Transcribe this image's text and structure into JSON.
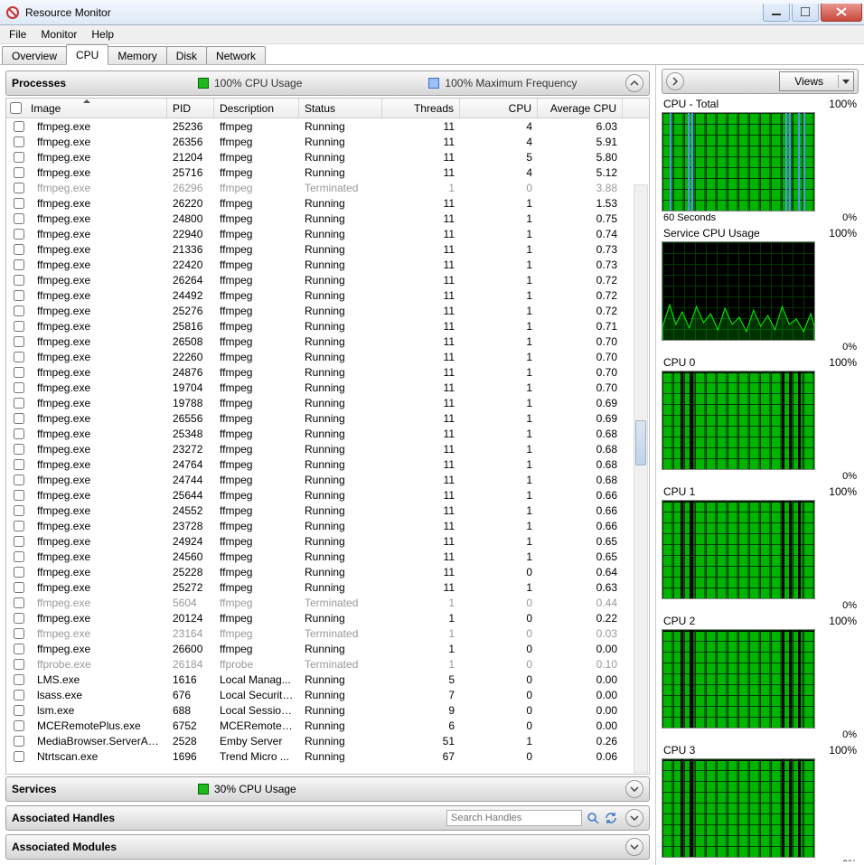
{
  "window": {
    "title": "Resource Monitor"
  },
  "menu": [
    "File",
    "Monitor",
    "Help"
  ],
  "tabs": [
    "Overview",
    "CPU",
    "Memory",
    "Disk",
    "Network"
  ],
  "active_tab": 1,
  "processes_section": {
    "title": "Processes",
    "cpu_usage": "100% CPU Usage",
    "max_freq": "100% Maximum Frequency"
  },
  "columns": [
    "Image",
    "PID",
    "Description",
    "Status",
    "Threads",
    "CPU",
    "Average CPU"
  ],
  "rows": [
    {
      "image": "ffmpeg.exe",
      "pid": 25236,
      "desc": "ffmpeg",
      "status": "Running",
      "threads": 11,
      "cpu": 4,
      "avg": "6.03",
      "term": false
    },
    {
      "image": "ffmpeg.exe",
      "pid": 26356,
      "desc": "ffmpeg",
      "status": "Running",
      "threads": 11,
      "cpu": 4,
      "avg": "5.91",
      "term": false
    },
    {
      "image": "ffmpeg.exe",
      "pid": 21204,
      "desc": "ffmpeg",
      "status": "Running",
      "threads": 11,
      "cpu": 5,
      "avg": "5.80",
      "term": false
    },
    {
      "image": "ffmpeg.exe",
      "pid": 25716,
      "desc": "ffmpeg",
      "status": "Running",
      "threads": 11,
      "cpu": 4,
      "avg": "5.12",
      "term": false
    },
    {
      "image": "ffmpeg.exe",
      "pid": 26296,
      "desc": "ffmpeg",
      "status": "Terminated",
      "threads": 1,
      "cpu": 0,
      "avg": "3.88",
      "term": true
    },
    {
      "image": "ffmpeg.exe",
      "pid": 26220,
      "desc": "ffmpeg",
      "status": "Running",
      "threads": 11,
      "cpu": 1,
      "avg": "1.53",
      "term": false
    },
    {
      "image": "ffmpeg.exe",
      "pid": 24800,
      "desc": "ffmpeg",
      "status": "Running",
      "threads": 11,
      "cpu": 1,
      "avg": "0.75",
      "term": false
    },
    {
      "image": "ffmpeg.exe",
      "pid": 22940,
      "desc": "ffmpeg",
      "status": "Running",
      "threads": 11,
      "cpu": 1,
      "avg": "0.74",
      "term": false
    },
    {
      "image": "ffmpeg.exe",
      "pid": 21336,
      "desc": "ffmpeg",
      "status": "Running",
      "threads": 11,
      "cpu": 1,
      "avg": "0.73",
      "term": false
    },
    {
      "image": "ffmpeg.exe",
      "pid": 22420,
      "desc": "ffmpeg",
      "status": "Running",
      "threads": 11,
      "cpu": 1,
      "avg": "0.73",
      "term": false
    },
    {
      "image": "ffmpeg.exe",
      "pid": 26264,
      "desc": "ffmpeg",
      "status": "Running",
      "threads": 11,
      "cpu": 1,
      "avg": "0.72",
      "term": false
    },
    {
      "image": "ffmpeg.exe",
      "pid": 24492,
      "desc": "ffmpeg",
      "status": "Running",
      "threads": 11,
      "cpu": 1,
      "avg": "0.72",
      "term": false
    },
    {
      "image": "ffmpeg.exe",
      "pid": 25276,
      "desc": "ffmpeg",
      "status": "Running",
      "threads": 11,
      "cpu": 1,
      "avg": "0.72",
      "term": false
    },
    {
      "image": "ffmpeg.exe",
      "pid": 25816,
      "desc": "ffmpeg",
      "status": "Running",
      "threads": 11,
      "cpu": 1,
      "avg": "0.71",
      "term": false
    },
    {
      "image": "ffmpeg.exe",
      "pid": 26508,
      "desc": "ffmpeg",
      "status": "Running",
      "threads": 11,
      "cpu": 1,
      "avg": "0.70",
      "term": false
    },
    {
      "image": "ffmpeg.exe",
      "pid": 22260,
      "desc": "ffmpeg",
      "status": "Running",
      "threads": 11,
      "cpu": 1,
      "avg": "0.70",
      "term": false
    },
    {
      "image": "ffmpeg.exe",
      "pid": 24876,
      "desc": "ffmpeg",
      "status": "Running",
      "threads": 11,
      "cpu": 1,
      "avg": "0.70",
      "term": false
    },
    {
      "image": "ffmpeg.exe",
      "pid": 19704,
      "desc": "ffmpeg",
      "status": "Running",
      "threads": 11,
      "cpu": 1,
      "avg": "0.70",
      "term": false
    },
    {
      "image": "ffmpeg.exe",
      "pid": 19788,
      "desc": "ffmpeg",
      "status": "Running",
      "threads": 11,
      "cpu": 1,
      "avg": "0.69",
      "term": false
    },
    {
      "image": "ffmpeg.exe",
      "pid": 26556,
      "desc": "ffmpeg",
      "status": "Running",
      "threads": 11,
      "cpu": 1,
      "avg": "0.69",
      "term": false
    },
    {
      "image": "ffmpeg.exe",
      "pid": 25348,
      "desc": "ffmpeg",
      "status": "Running",
      "threads": 11,
      "cpu": 1,
      "avg": "0.68",
      "term": false
    },
    {
      "image": "ffmpeg.exe",
      "pid": 23272,
      "desc": "ffmpeg",
      "status": "Running",
      "threads": 11,
      "cpu": 1,
      "avg": "0.68",
      "term": false
    },
    {
      "image": "ffmpeg.exe",
      "pid": 24764,
      "desc": "ffmpeg",
      "status": "Running",
      "threads": 11,
      "cpu": 1,
      "avg": "0.68",
      "term": false
    },
    {
      "image": "ffmpeg.exe",
      "pid": 24744,
      "desc": "ffmpeg",
      "status": "Running",
      "threads": 11,
      "cpu": 1,
      "avg": "0.68",
      "term": false
    },
    {
      "image": "ffmpeg.exe",
      "pid": 25644,
      "desc": "ffmpeg",
      "status": "Running",
      "threads": 11,
      "cpu": 1,
      "avg": "0.66",
      "term": false
    },
    {
      "image": "ffmpeg.exe",
      "pid": 24552,
      "desc": "ffmpeg",
      "status": "Running",
      "threads": 11,
      "cpu": 1,
      "avg": "0.66",
      "term": false
    },
    {
      "image": "ffmpeg.exe",
      "pid": 23728,
      "desc": "ffmpeg",
      "status": "Running",
      "threads": 11,
      "cpu": 1,
      "avg": "0.66",
      "term": false
    },
    {
      "image": "ffmpeg.exe",
      "pid": 24924,
      "desc": "ffmpeg",
      "status": "Running",
      "threads": 11,
      "cpu": 1,
      "avg": "0.65",
      "term": false
    },
    {
      "image": "ffmpeg.exe",
      "pid": 24560,
      "desc": "ffmpeg",
      "status": "Running",
      "threads": 11,
      "cpu": 1,
      "avg": "0.65",
      "term": false
    },
    {
      "image": "ffmpeg.exe",
      "pid": 25228,
      "desc": "ffmpeg",
      "status": "Running",
      "threads": 11,
      "cpu": 0,
      "avg": "0.64",
      "term": false
    },
    {
      "image": "ffmpeg.exe",
      "pid": 25272,
      "desc": "ffmpeg",
      "status": "Running",
      "threads": 11,
      "cpu": 1,
      "avg": "0.63",
      "term": false
    },
    {
      "image": "ffmpeg.exe",
      "pid": 5604,
      "desc": "ffmpeg",
      "status": "Terminated",
      "threads": 1,
      "cpu": 0,
      "avg": "0.44",
      "term": true
    },
    {
      "image": "ffmpeg.exe",
      "pid": 20124,
      "desc": "ffmpeg",
      "status": "Running",
      "threads": 1,
      "cpu": 0,
      "avg": "0.22",
      "term": false
    },
    {
      "image": "ffmpeg.exe",
      "pid": 23164,
      "desc": "ffmpeg",
      "status": "Terminated",
      "threads": 1,
      "cpu": 0,
      "avg": "0.03",
      "term": true
    },
    {
      "image": "ffmpeg.exe",
      "pid": 26600,
      "desc": "ffmpeg",
      "status": "Running",
      "threads": 1,
      "cpu": 0,
      "avg": "0.00",
      "term": false
    },
    {
      "image": "ffprobe.exe",
      "pid": 26184,
      "desc": "ffprobe",
      "status": "Terminated",
      "threads": 1,
      "cpu": 0,
      "avg": "0.10",
      "term": true
    },
    {
      "image": "LMS.exe",
      "pid": 1616,
      "desc": "Local Manag...",
      "status": "Running",
      "threads": 5,
      "cpu": 0,
      "avg": "0.00",
      "term": false
    },
    {
      "image": "lsass.exe",
      "pid": 676,
      "desc": "Local Security...",
      "status": "Running",
      "threads": 7,
      "cpu": 0,
      "avg": "0.00",
      "term": false
    },
    {
      "image": "lsm.exe",
      "pid": 688,
      "desc": "Local Session...",
      "status": "Running",
      "threads": 9,
      "cpu": 0,
      "avg": "0.00",
      "term": false
    },
    {
      "image": "MCERemotePlus.exe",
      "pid": 6752,
      "desc": "MCERemoteP...",
      "status": "Running",
      "threads": 6,
      "cpu": 0,
      "avg": "0.00",
      "term": false
    },
    {
      "image": "MediaBrowser.ServerApplic...",
      "pid": 2528,
      "desc": "Emby Server",
      "status": "Running",
      "threads": 51,
      "cpu": 1,
      "avg": "0.26",
      "term": false
    },
    {
      "image": "Ntrtscan.exe",
      "pid": 1696,
      "desc": "Trend Micro ...",
      "status": "Running",
      "threads": 67,
      "cpu": 0,
      "avg": "0.06",
      "term": false
    }
  ],
  "services_section": {
    "title": "Services",
    "cpu_usage": "30% CPU Usage"
  },
  "handles_section": {
    "title": "Associated Handles",
    "search_placeholder": "Search Handles"
  },
  "modules_section": {
    "title": "Associated Modules"
  },
  "right_pane": {
    "views": "Views",
    "graphs": [
      {
        "title": "CPU - Total",
        "pct": "100%",
        "foot_left": "60 Seconds",
        "foot_right": "0%",
        "type": "cpu-total"
      },
      {
        "title": "Service CPU Usage",
        "pct": "100%",
        "foot_left": "",
        "foot_right": "0%",
        "type": "service"
      },
      {
        "title": "CPU 0",
        "pct": "100%",
        "foot_left": "",
        "foot_right": "0%",
        "type": "cpu-core"
      },
      {
        "title": "CPU 1",
        "pct": "100%",
        "foot_left": "",
        "foot_right": "0%",
        "type": "cpu-core"
      },
      {
        "title": "CPU 2",
        "pct": "100%",
        "foot_left": "",
        "foot_right": "0%",
        "type": "cpu-core"
      },
      {
        "title": "CPU 3",
        "pct": "100%",
        "foot_left": "",
        "foot_right": "0%",
        "type": "cpu-core"
      }
    ]
  },
  "chart_data": {
    "type": "line",
    "note": "Per-core CPU% over the last 60 seconds; all cores sustained ~100%. Service CPU Usage fluctuates ~5–40%.",
    "x_range_seconds": [
      0,
      60
    ],
    "y_range_pct": [
      0,
      100
    ],
    "series": [
      {
        "name": "CPU - Total",
        "approx_pct": 100
      },
      {
        "name": "Service CPU Usage",
        "approx_pct_range": [
          5,
          40
        ]
      },
      {
        "name": "CPU 0",
        "approx_pct": 100
      },
      {
        "name": "CPU 1",
        "approx_pct": 100
      },
      {
        "name": "CPU 2",
        "approx_pct": 100
      },
      {
        "name": "CPU 3",
        "approx_pct": 100
      }
    ]
  }
}
